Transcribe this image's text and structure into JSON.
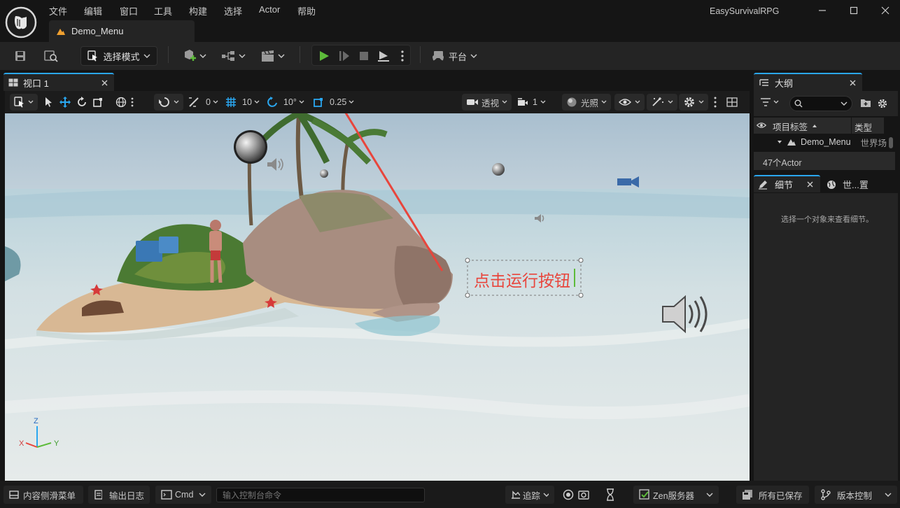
{
  "app": {
    "window_title": "EasySurvivalRPG",
    "doc_tab": "Demo_Menu"
  },
  "menu": [
    "文件",
    "编辑",
    "窗口",
    "工具",
    "构建",
    "选择",
    "Actor",
    "帮助"
  ],
  "toolbar": {
    "select_mode": "选择模式",
    "platform": "平台"
  },
  "viewport": {
    "tab": "视口 1",
    "rot_snap": "0",
    "grid_snap": "10",
    "angle_snap": "10°",
    "scale_snap": "0.25",
    "view_mode": "透视",
    "speed": "1",
    "lighting": "光照",
    "annotation": "点击运行按钮",
    "axis": {
      "z": "Z",
      "x": "X",
      "y": "Y"
    }
  },
  "outliner": {
    "tab": "大纲",
    "col_label": "项目标签",
    "col_type": "类型",
    "item_name": "Demo_Menu",
    "item_type": "世界场",
    "count": "47个Actor"
  },
  "details": {
    "tab": "细节",
    "tab2": "世...置",
    "empty": "选择一个对象来查看细节。"
  },
  "bottom": {
    "content_drawer": "内容侧滑菜单",
    "output_log": "输出日志",
    "cmd": "Cmd",
    "cmd_placeholder": "输入控制台命令",
    "trace": "追踪",
    "zen": "Zen服务器",
    "saved": "所有已保存",
    "source_control": "版本控制"
  },
  "colors": {
    "accent": "#2aa7f0",
    "play": "#5dbb3a",
    "annotation": "#e8453c"
  }
}
